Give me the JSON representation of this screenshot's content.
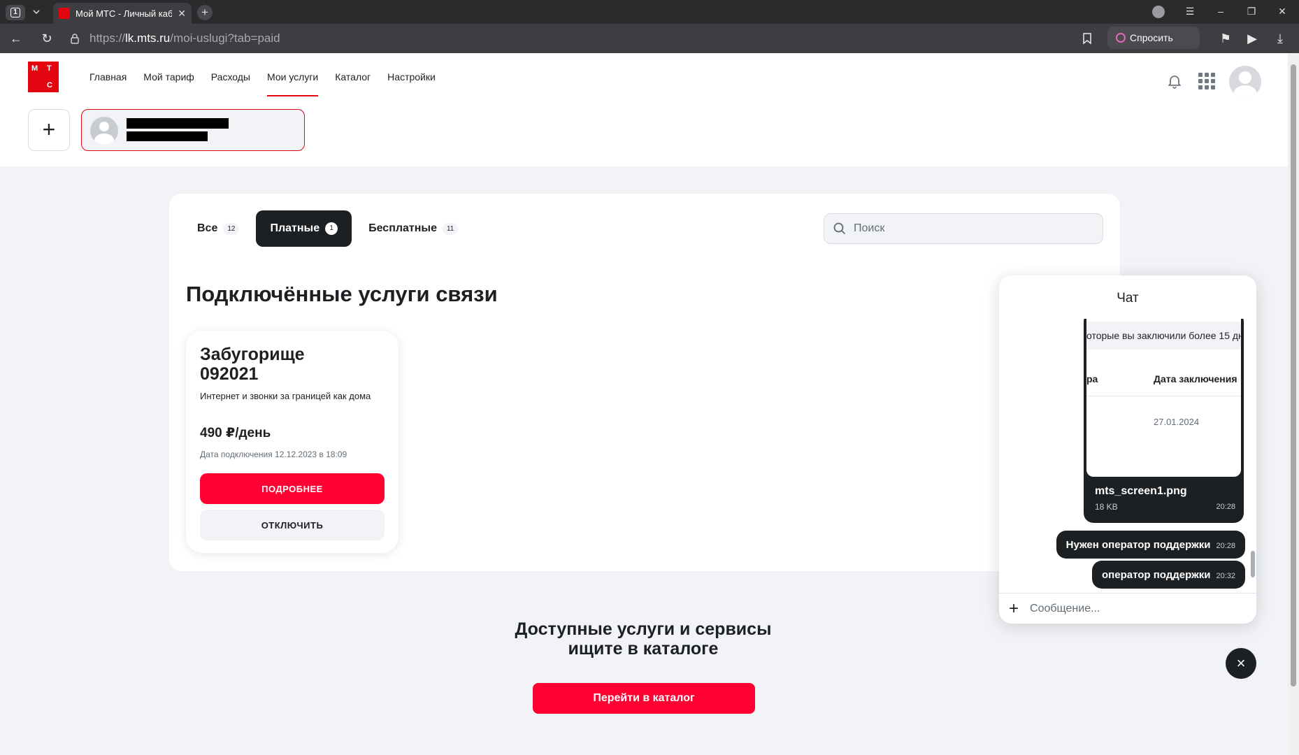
{
  "browser": {
    "tab_counter": "1",
    "tab_title": "Мой МТС - Личный кабинет",
    "url_scheme": "https://",
    "url_host": "lk.mts.ru",
    "url_path": "/moi-uslugi?tab=paid",
    "ask_label": "Спросить"
  },
  "logo": {
    "l1": "М",
    "l2": "Т",
    "l3": "С"
  },
  "nav": {
    "items": [
      {
        "label": "Главная"
      },
      {
        "label": "Мой тариф"
      },
      {
        "label": "Расходы"
      },
      {
        "label": "Мои услуги"
      },
      {
        "label": "Каталог"
      },
      {
        "label": "Настройки"
      }
    ],
    "active_index": 3
  },
  "accounts": {
    "add_label": "+"
  },
  "tabs": [
    {
      "label": "Все",
      "count": "12"
    },
    {
      "label": "Платные",
      "count": "1"
    },
    {
      "label": "Бесплатные",
      "count": "11"
    }
  ],
  "search": {
    "placeholder": "Поиск"
  },
  "section_title": "Подключённые услуги связи",
  "service": {
    "name": "Забугорище 092021",
    "description": "Интернет и звонки за границей как дома",
    "price": "490 ₽/день",
    "connected": "Дата подключения 12.12.2023 в 18:09",
    "details_label": "подробнее",
    "disable_label": "отключить"
  },
  "catalog": {
    "text_line1": "Доступные услуги и сервисы",
    "text_line2": "ищите в каталоге",
    "button_label": "Перейти в каталог"
  },
  "chat": {
    "title": "Чат",
    "screenshot": {
      "line1": "оторые вы заключили более 15 дн",
      "col_a": "ра",
      "col_b": "Дата заключения",
      "date": "27.01.2024"
    },
    "file": {
      "name": "mts_screen1.png",
      "size": "18 KB",
      "time": "20:28"
    },
    "messages": [
      {
        "text": "Нужен оператор поддержки",
        "time": "20:28"
      },
      {
        "text": "оператор поддержки",
        "time": "20:32"
      }
    ],
    "input_placeholder": "Сообщение...",
    "close_label": "×"
  },
  "colors": {
    "brand_red": "#ff0032",
    "logo_red": "#e30611",
    "dark": "#1d2023"
  }
}
